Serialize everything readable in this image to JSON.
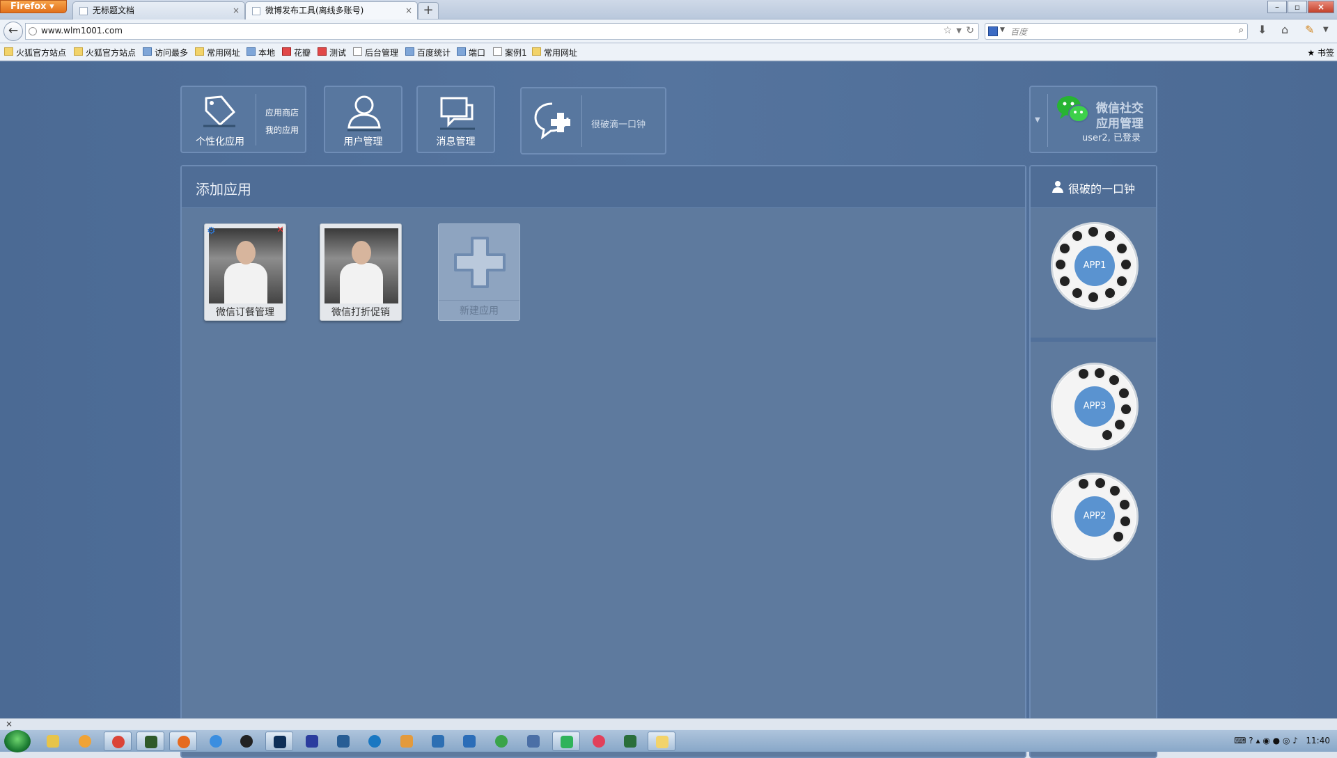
{
  "browser": {
    "menu_button": "Firefox",
    "tabs": [
      {
        "title": "无标题文档"
      },
      {
        "title": "微博发布工具(离线多账号)"
      }
    ],
    "new_tab": "+",
    "url": "www.wlm1001.com",
    "search_placeholder": "百度",
    "bookmarks": [
      "火狐官方站点",
      "火狐官方站点",
      "访问最多",
      "常用网址",
      "本地",
      "花瓣",
      "测试",
      "后台管理",
      "百度统计",
      "端口",
      "案例1",
      "常用网址"
    ],
    "bookmarks_right": "书签"
  },
  "top_nav": {
    "personal_apps": {
      "label": "个性化应用",
      "submenu": [
        "应用商店",
        "我的应用"
      ]
    },
    "user_mgmt": {
      "label": "用户管理"
    },
    "message_mgmt": {
      "label": "消息管理"
    },
    "account_tile": {
      "text": "很破滴一口钟"
    },
    "brand": {
      "line1": "微信社交",
      "line2": "应用管理",
      "status": "user2, 已登录"
    }
  },
  "main": {
    "title": "添加应用",
    "apps": [
      {
        "name": "微信订餐管理"
      },
      {
        "name": "微信打折促销"
      }
    ],
    "new_app_label": "新建应用"
  },
  "side": {
    "user": "很破的一口钟",
    "rings": [
      {
        "label": "APP1"
      },
      {
        "label": "APP3"
      },
      {
        "label": "APP2"
      }
    ]
  },
  "statusbar": {
    "close": "×"
  },
  "taskbar": {
    "clock": "11:40"
  }
}
